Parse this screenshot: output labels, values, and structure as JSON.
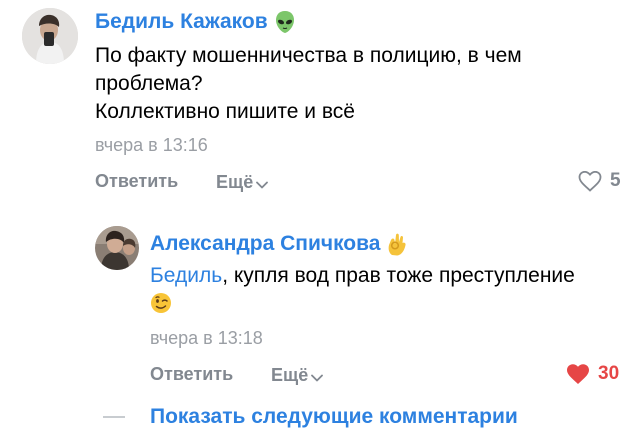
{
  "comments": [
    {
      "author": "Бедиль Кажаков",
      "author_emoji": "alien-emoji",
      "lines": [
        "По факту мошенничества в полицию, в чем",
        "проблема?",
        "Коллективно пишите и всё"
      ],
      "timestamp": "вчера в 13:16",
      "reply_label": "Ответить",
      "more_label": "Ещё",
      "likes": "5",
      "liked": false,
      "colors": {
        "like_icon": "#828890"
      }
    },
    {
      "author": "Александра Спичкова",
      "author_emoji": "ok-hand-emoji",
      "mention": "Бедиль",
      "text_after_mention": ", купля вод прав тоже преступление",
      "trailing_emoji": "winking-face-emoji",
      "timestamp": "вчера в 13:18",
      "reply_label": "Ответить",
      "more_label": "Ещё",
      "likes": "30",
      "liked": true,
      "colors": {
        "like_icon": "#e64646"
      }
    }
  ],
  "show_more_label": "Показать следующие комментарии",
  "colors": {
    "link": "#2d81e0",
    "secondary": "#828890",
    "timestamp": "#9a9ea4",
    "liked": "#e64646"
  }
}
